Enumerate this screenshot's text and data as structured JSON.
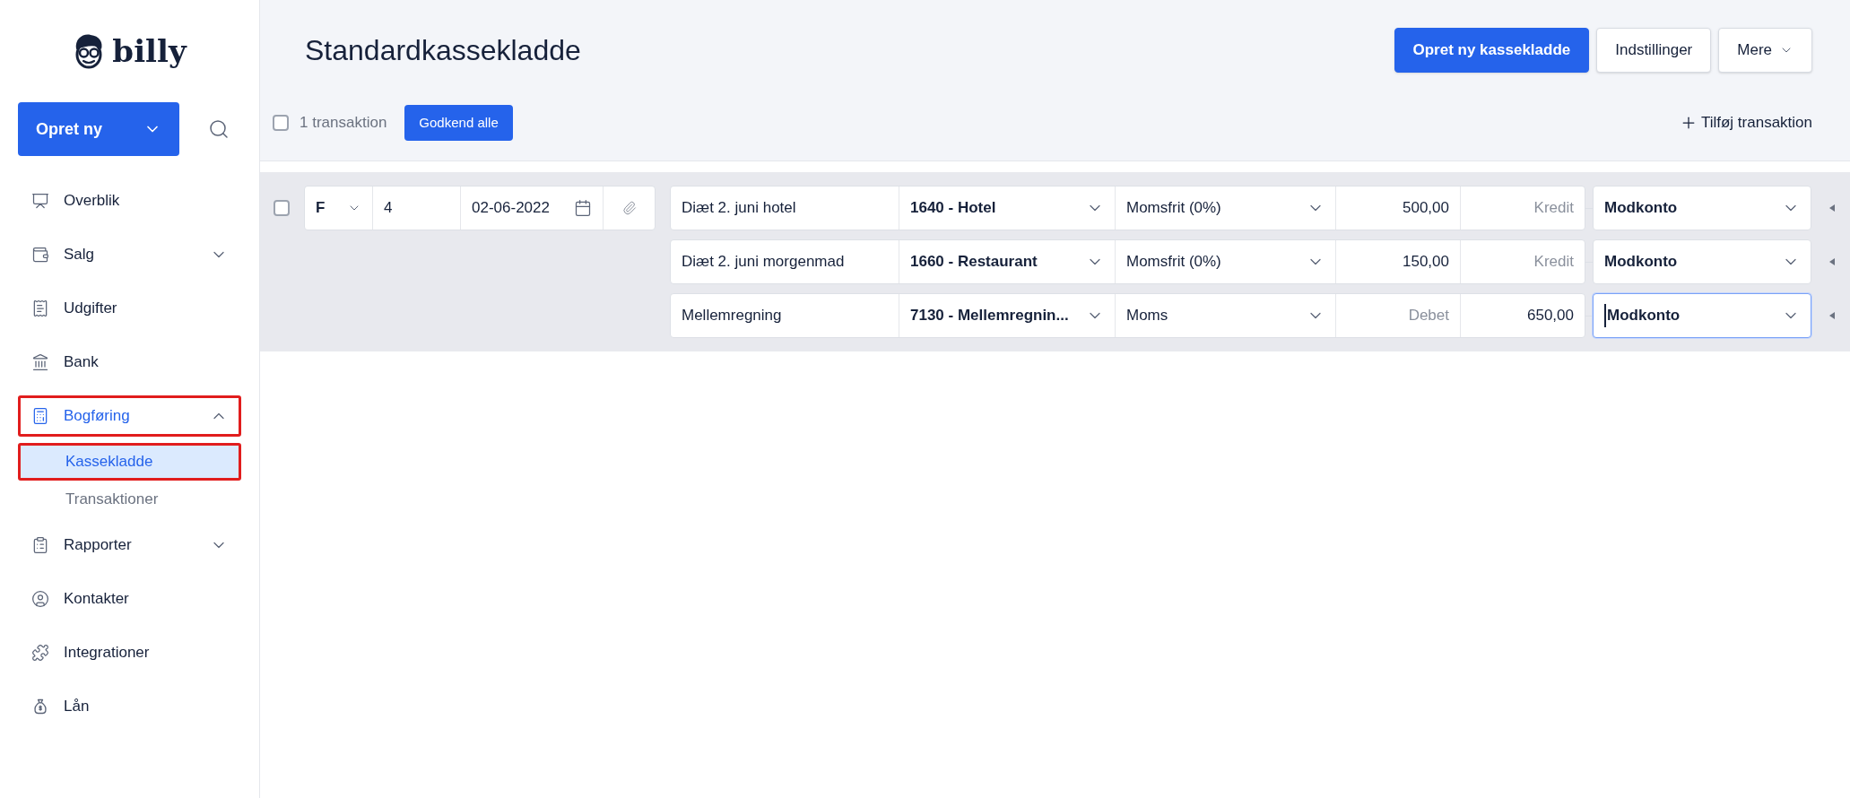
{
  "sidebar": {
    "logo": "billy",
    "create_button": "Opret ny",
    "items": [
      {
        "label": "Overblik",
        "selected": false
      },
      {
        "label": "Salg",
        "selected": false,
        "expanded": false
      },
      {
        "label": "Udgifter",
        "selected": false
      },
      {
        "label": "Bank",
        "selected": false
      },
      {
        "label": "Bogføring",
        "selected": true,
        "expanded": true,
        "annotated": true,
        "children": [
          {
            "label": "Kassekladde",
            "selected": true,
            "annotated": true
          },
          {
            "label": "Transaktioner",
            "selected": false,
            "annotated": false
          }
        ]
      },
      {
        "label": "Rapporter",
        "selected": false,
        "expanded": false
      },
      {
        "label": "Kontakter",
        "selected": false
      },
      {
        "label": "Integrationer",
        "selected": false
      },
      {
        "label": "Lån",
        "selected": false
      }
    ]
  },
  "header": {
    "title": "Standardkassekladde",
    "buttons": [
      {
        "label": "Opret ny kassekladde",
        "kind": "primary"
      },
      {
        "label": "Indstillinger",
        "kind": "secondary"
      },
      {
        "label": "Mere",
        "kind": "dropdown"
      }
    ]
  },
  "toolbar": {
    "select_all": {
      "label": "1 transaktion",
      "checked": false
    },
    "approve_button": "Godkend alle",
    "add_link": "Tilføj transaktion"
  },
  "transactions": [
    {
      "checked": false,
      "type": "F",
      "number": "4",
      "date": "02-06-2022",
      "lines": [
        {
          "description": "Diæt 2. juni hotel",
          "account": "1640 - Hotel",
          "vat": "Momsfrit (0%)",
          "debit": {
            "value": "500,00"
          },
          "credit": {
            "placeholder": "Kredit"
          },
          "contra": "Modkonto",
          "focused": false
        },
        {
          "description": "Diæt 2. juni morgenmad",
          "account": "1660 - Restaurant",
          "vat": "Momsfrit (0%)",
          "debit": {
            "value": "150,00"
          },
          "credit": {
            "placeholder": "Kredit"
          },
          "contra": "Modkonto",
          "focused": false
        },
        {
          "description": "Mellemregning",
          "account": "7130 - Mellemregnin...",
          "vat": "Moms",
          "debit": {
            "placeholder": "Debet"
          },
          "credit": {
            "value": "650,00"
          },
          "contra": "Modkonto",
          "focused": true
        }
      ]
    }
  ]
}
